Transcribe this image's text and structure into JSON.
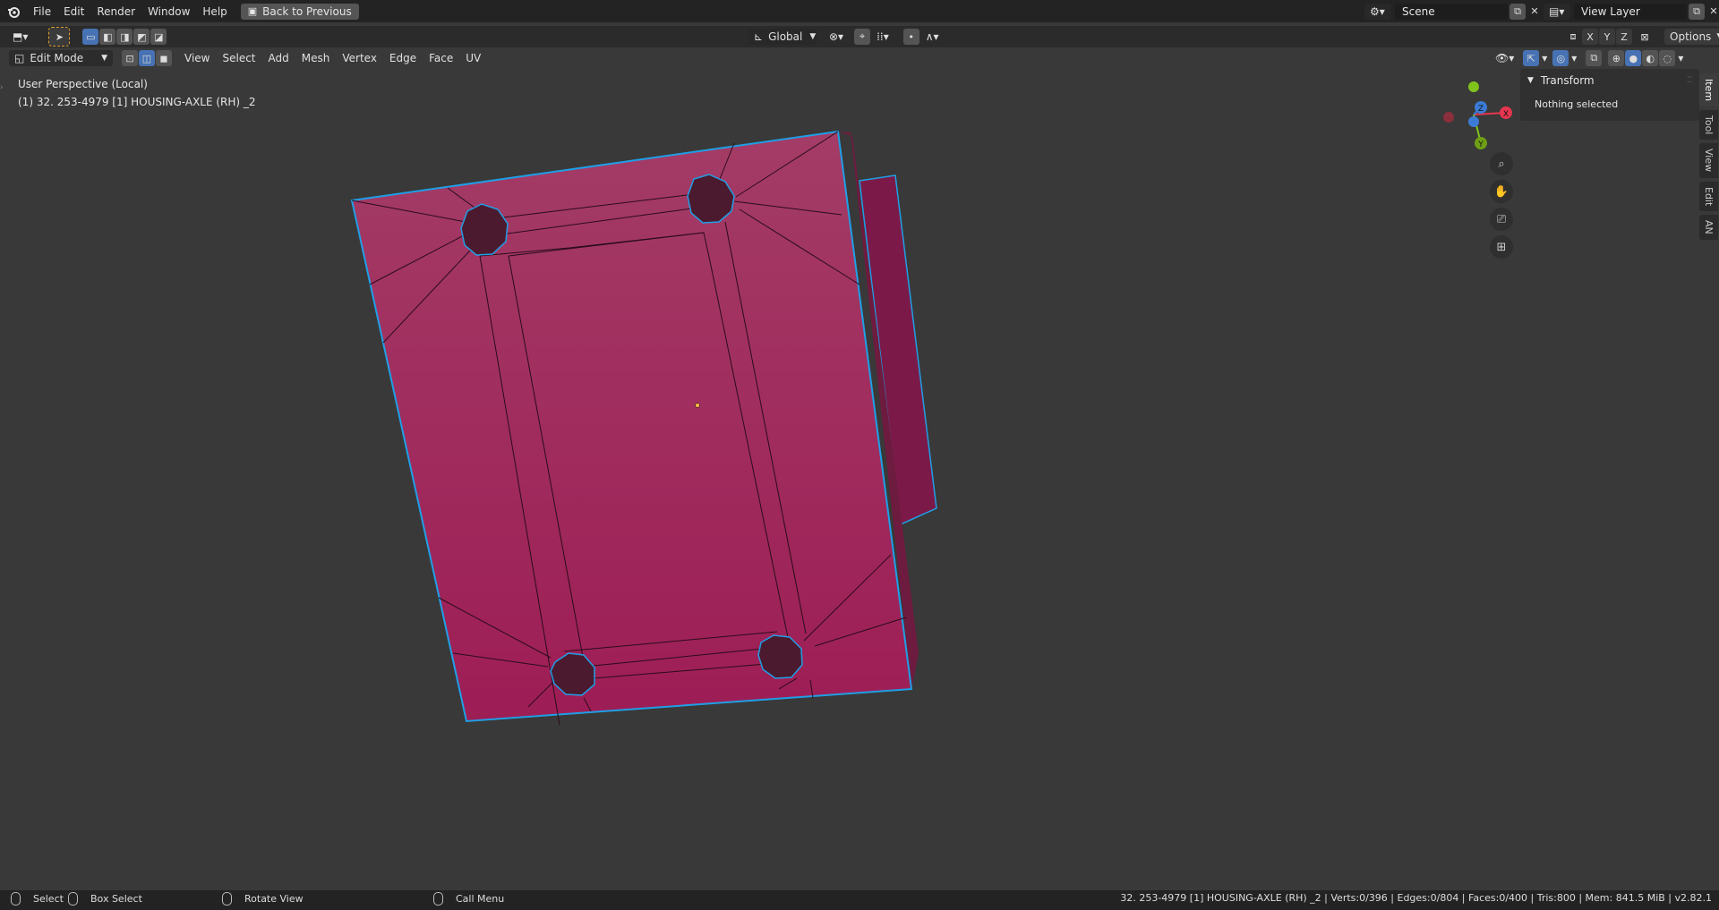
{
  "topbar": {
    "menus": [
      "File",
      "Edit",
      "Render",
      "Window",
      "Help"
    ],
    "back_button": "Back to Previous",
    "scene": "Scene",
    "view_layer": "View Layer"
  },
  "header": {
    "transform_orientation": "Global",
    "options": "Options",
    "mode": "Edit Mode",
    "menus": [
      "View",
      "Select",
      "Add",
      "Mesh",
      "Vertex",
      "Edge",
      "Face",
      "UV"
    ],
    "axes": [
      "X",
      "Y",
      "Z"
    ]
  },
  "viewport": {
    "perspective": "User Perspective (Local)",
    "object_info": "(1) 32. 253-4979 [1] HOUSING-AXLE (RH) _2"
  },
  "gizmo": {
    "x": "X",
    "y": "Y",
    "z": "Z"
  },
  "sidebar": {
    "panel_title": "Transform",
    "panel_text": "Nothing selected",
    "tabs": [
      "Item",
      "Tool",
      "View",
      "Edit",
      "AN"
    ]
  },
  "status": {
    "select": "Select",
    "box_select": "Box Select",
    "rotate_view": "Rotate View",
    "call_menu": "Call Menu",
    "stats": "32. 253-4979 [1] HOUSING-AXLE (RH) _2 | Verts:0/396 | Edges:0/804 | Faces:0/400 | Tris:800 | Mem: 841.5 MiB | v2.82.1"
  },
  "colors": {
    "mesh_face": "#a3285c",
    "edge_highlight": "#1f9fe6",
    "axis_x": "#e5364f",
    "axis_y": "#7fc31c",
    "axis_z": "#3b7bd6"
  }
}
